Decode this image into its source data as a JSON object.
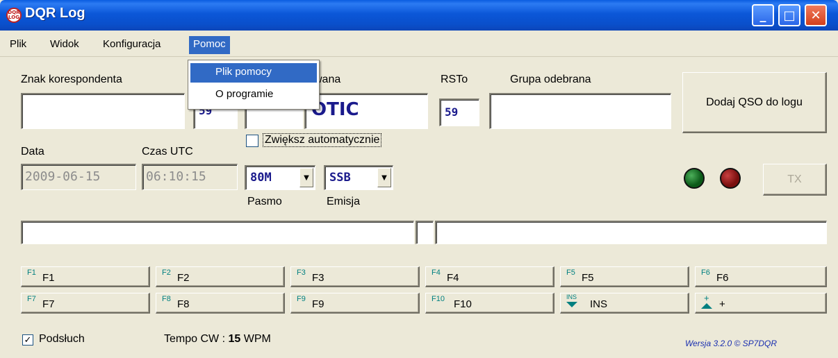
{
  "window": {
    "title": "DQR Log",
    "logo_text": "DQR LOG",
    "minimize": "_",
    "maximize": "□",
    "close": "✕"
  },
  "menubar": {
    "items": [
      "Plik",
      "Widok",
      "Konfiguracja",
      "Pomoc"
    ]
  },
  "help_menu": {
    "items": [
      "Plik pomocy",
      "O programie"
    ]
  },
  "form": {
    "callsign_label": "Znak korespondenta",
    "callsign_value": "",
    "rsts_value": "59",
    "sent_group_label_partial": "wana",
    "sent_group_number": "",
    "sent_group_value": "OTIC",
    "rsto_label": "RSTo",
    "rsto_value": "59",
    "received_group_label": "Grupa odebrana",
    "received_group_value": "",
    "add_qso_button": "Dodaj QSO do logu",
    "auto_increment_label": "Zwiększ automatycznie",
    "date_label": "Data",
    "date_value": "2009-06-15",
    "time_label": "Czas UTC",
    "time_value": "06:10:15",
    "band_value": "80M",
    "band_label": "Pasmo",
    "mode_value": "SSB",
    "mode_label": "Emisja",
    "tx_button": "TX"
  },
  "colors": {
    "led_green": "#0B5A18",
    "led_red": "#7A0F0F",
    "accent": "#316AC5",
    "value_blue": "#1A1A8C"
  },
  "fkeys": [
    {
      "key": "F1",
      "label": "F1"
    },
    {
      "key": "F2",
      "label": "F2"
    },
    {
      "key": "F3",
      "label": "F3"
    },
    {
      "key": "F4",
      "label": "F4"
    },
    {
      "key": "F5",
      "label": "F5"
    },
    {
      "key": "F6",
      "label": "F6"
    },
    {
      "key": "F7",
      "label": "F7"
    },
    {
      "key": "F8",
      "label": "F8"
    },
    {
      "key": "F9",
      "label": "F9"
    },
    {
      "key": "F10",
      "label": "F10"
    },
    {
      "key": "INS",
      "label": "INS",
      "icon": "arrow-down-icon"
    },
    {
      "key": "+",
      "label": "+",
      "icon": "arrow-up-icon"
    }
  ],
  "footer": {
    "monitor_label": "Podsłuch",
    "monitor_checked": true,
    "cw_speed_prefix": "Tempo CW : ",
    "cw_speed_value": "15",
    "cw_speed_unit": " WPM",
    "version": "Wersja 3.2.0 © SP7DQR"
  }
}
